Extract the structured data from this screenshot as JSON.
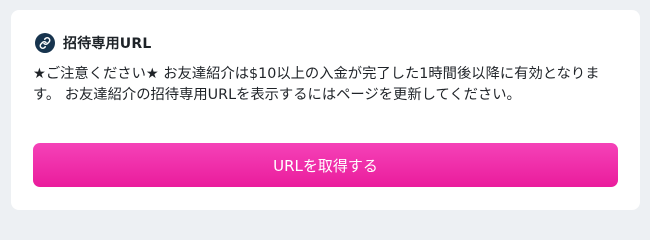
{
  "card": {
    "title": "招待専用URL",
    "icon": "link-icon",
    "notice": "★ご注意ください★ お友達紹介は$10以上の入金が完了した1時間後以降に有効となります。 お友達紹介の招待専用URLを表示するにはページを更新してください。",
    "button_label": "URLを取得する"
  },
  "colors": {
    "page_background": "#edf0f3",
    "card_background": "#ffffff",
    "icon_badge": "#17344e",
    "button_gradient_top": "#f542b8",
    "button_gradient_bottom": "#ea1c9c",
    "text": "#1f2328"
  }
}
